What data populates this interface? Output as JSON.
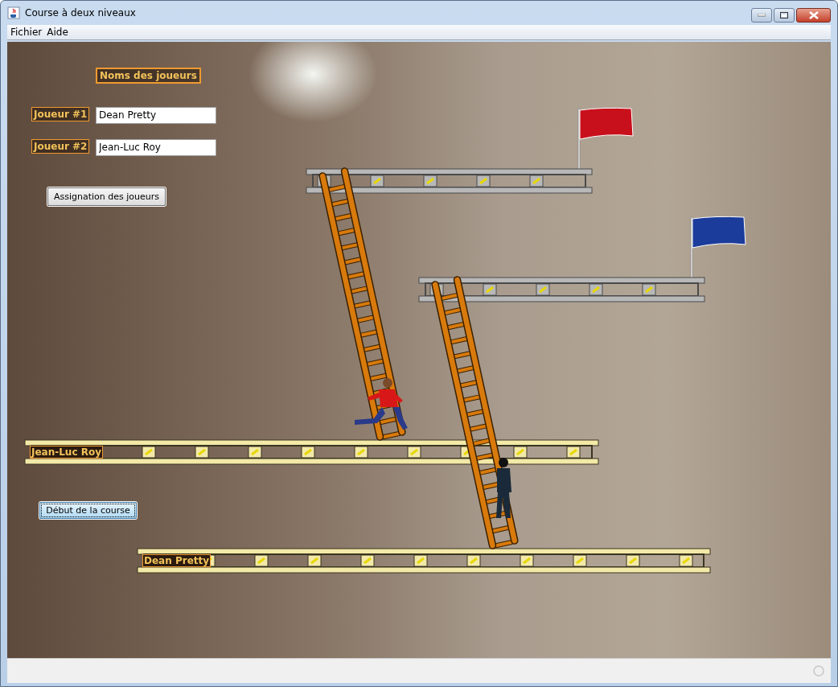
{
  "window": {
    "title": "Course à deux niveaux"
  },
  "menu": [
    "Fichier",
    "Aide"
  ],
  "players_panel": {
    "heading": "Noms des joueurs",
    "players": [
      {
        "label": "Joueur #1",
        "value": "Dean Pretty"
      },
      {
        "label": "Joueur #2",
        "value": "Jean-Luc Roy"
      }
    ],
    "assign_button": "Assignation des joueurs"
  },
  "start_button": "Début de la course",
  "lanes": [
    {
      "name": "Jean-Luc Roy"
    },
    {
      "name": "Dean Pretty"
    }
  ]
}
